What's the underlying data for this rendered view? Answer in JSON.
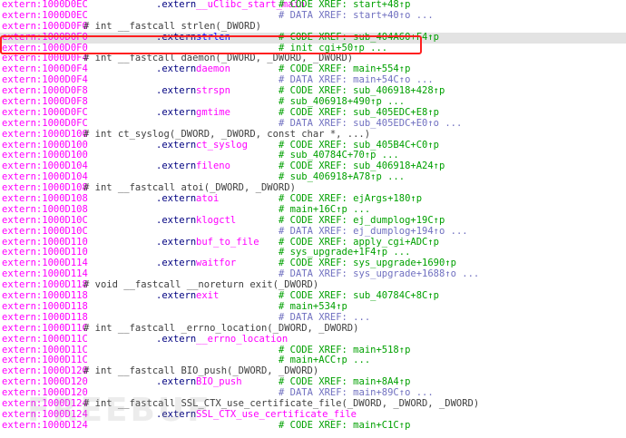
{
  "lines": [
    {
      "addr": "extern:1000D0EC",
      "directive": ".extern",
      "symbol": "__uClibc_start_main",
      "xref": "# CODE XREF: start+48↑p",
      "xref_type": "code"
    },
    {
      "addr": "extern:1000D0EC",
      "xref": "# DATA XREF: start+40↑o ...",
      "xref_type": "data"
    },
    {
      "addr": "extern:1000D0F0",
      "comment": "# int __fastcall strlen(_DWORD)"
    },
    {
      "addr": "extern:1000D0F0",
      "directive": ".extern",
      "symbol": "strlen",
      "xref": "# CODE XREF: sub_404A60+F4↑p",
      "xref_type": "code",
      "highlight": true
    },
    {
      "addr": "extern:1000D0F0",
      "xref": "# init_cgi+50↑p ...",
      "xref_type": "code"
    },
    {
      "addr": "extern:1000D0F4",
      "comment": "# int __fastcall daemon(_DWORD, _DWORD, _DWORD)"
    },
    {
      "addr": "extern:1000D0F4",
      "directive": ".extern",
      "symbol": "daemon",
      "xref": "# CODE XREF: main+554↑p",
      "xref_type": "code"
    },
    {
      "addr": "extern:1000D0F4",
      "xref": "# DATA XREF: main+54C↑o ...",
      "xref_type": "data"
    },
    {
      "addr": "extern:1000D0F8",
      "directive": ".extern",
      "symbol": "strspn",
      "xref": "# CODE XREF: sub_406918+428↑p",
      "xref_type": "code"
    },
    {
      "addr": "extern:1000D0F8",
      "xref": "# sub_406918+490↑p ...",
      "xref_type": "code"
    },
    {
      "addr": "extern:1000D0FC",
      "directive": ".extern",
      "symbol": "gmtime",
      "xref": "# CODE XREF: sub_405EDC+E8↑p",
      "xref_type": "code"
    },
    {
      "addr": "extern:1000D0FC",
      "xref": "# DATA XREF: sub_405EDC+E0↑o ...",
      "xref_type": "data"
    },
    {
      "addr": "extern:1000D100",
      "comment": "# int ct_syslog(_DWORD, _DWORD, const char *, ...)"
    },
    {
      "addr": "extern:1000D100",
      "directive": ".extern",
      "symbol": "ct_syslog",
      "xref": "# CODE XREF: sub_405B4C+C0↑p",
      "xref_type": "code"
    },
    {
      "addr": "extern:1000D100",
      "xref": "# sub_40784C+70↑p ...",
      "xref_type": "code"
    },
    {
      "addr": "extern:1000D104",
      "directive": ".extern",
      "symbol": "fileno",
      "xref": "# CODE XREF: sub_406918+A24↑p",
      "xref_type": "code"
    },
    {
      "addr": "extern:1000D104",
      "xref": "# sub_406918+A78↑p ...",
      "xref_type": "code"
    },
    {
      "addr": "extern:1000D108",
      "comment": "# int __fastcall atoi(_DWORD, _DWORD)"
    },
    {
      "addr": "extern:1000D108",
      "directive": ".extern",
      "symbol": "atoi",
      "xref": "# CODE XREF: ejArgs+180↑p",
      "xref_type": "code"
    },
    {
      "addr": "extern:1000D108",
      "xref": "# main+16C↑p ...",
      "xref_type": "code"
    },
    {
      "addr": "extern:1000D10C",
      "directive": ".extern",
      "symbol": "klogctl",
      "xref": "# CODE XREF: ej_dumplog+19C↑p",
      "xref_type": "code"
    },
    {
      "addr": "extern:1000D10C",
      "xref": "# DATA XREF: ej_dumplog+194↑o ...",
      "xref_type": "data"
    },
    {
      "addr": "extern:1000D110",
      "directive": ".extern",
      "symbol": "buf_to_file",
      "xref": "# CODE XREF: apply_cgi+ADC↑p",
      "xref_type": "code"
    },
    {
      "addr": "extern:1000D110",
      "xref": "# sys_upgrade+1F4↑p ...",
      "xref_type": "code"
    },
    {
      "addr": "extern:1000D114",
      "directive": ".extern",
      "symbol": "waitfor",
      "xref": "# CODE XREF: sys_upgrade+1690↑p",
      "xref_type": "code"
    },
    {
      "addr": "extern:1000D114",
      "xref": "# DATA XREF: sys_upgrade+1688↑o ...",
      "xref_type": "data"
    },
    {
      "addr": "extern:1000D118",
      "comment": "# void __fastcall __noreturn exit(_DWORD)"
    },
    {
      "addr": "extern:1000D118",
      "directive": ".extern",
      "symbol": "exit",
      "xref": "# CODE XREF: sub_40784C+8C↑p",
      "xref_type": "code"
    },
    {
      "addr": "extern:1000D118",
      "xref": "# main+534↑p",
      "xref_type": "code"
    },
    {
      "addr": "extern:1000D118",
      "xref": "# DATA XREF: ...",
      "xref_type": "data"
    },
    {
      "addr": "extern:1000D11C",
      "comment": "# int __fastcall _errno_location(_DWORD, _DWORD)"
    },
    {
      "addr": "extern:1000D11C",
      "directive": ".extern",
      "symbol": "__errno_location",
      "xref": "",
      "xref_type": "code"
    },
    {
      "addr": "extern:1000D11C",
      "xref": "# CODE XREF: main+518↑p",
      "xref_type": "code"
    },
    {
      "addr": "extern:1000D11C",
      "xref": "# main+ACC↑p ...",
      "xref_type": "code"
    },
    {
      "addr": "extern:1000D120",
      "comment": "# int __fastcall BIO_push(_DWORD, _DWORD)"
    },
    {
      "addr": "extern:1000D120",
      "directive": ".extern",
      "symbol": "BIO_push",
      "xref": "# CODE XREF: main+8A4↑p",
      "xref_type": "code"
    },
    {
      "addr": "extern:1000D120",
      "xref": "# DATA XREF: main+89C↑o ...",
      "xref_type": "data"
    },
    {
      "addr": "extern:1000D124",
      "comment": "# int __fastcall SSL_CTX_use_certificate_file(_DWORD, _DWORD, _DWORD)"
    },
    {
      "addr": "extern:1000D124",
      "directive": ".extern",
      "symbol": "SSL_CTX_use_certificate_file",
      "xref": "",
      "xref_type": "code"
    },
    {
      "addr": "extern:1000D124",
      "xref": "# CODE XREF: main+C1C↑p",
      "xref_type": "code"
    }
  ],
  "watermark": "FREEBUF",
  "colors": {
    "address": "#ff00ff",
    "directive": "#000080",
    "symbol": "#ff00ff",
    "code_xref": "#00a000",
    "data_xref": "#7070c0",
    "comment": "#404040",
    "selection_box": "#ff2020",
    "highlight_row": "#e3e3e3"
  }
}
